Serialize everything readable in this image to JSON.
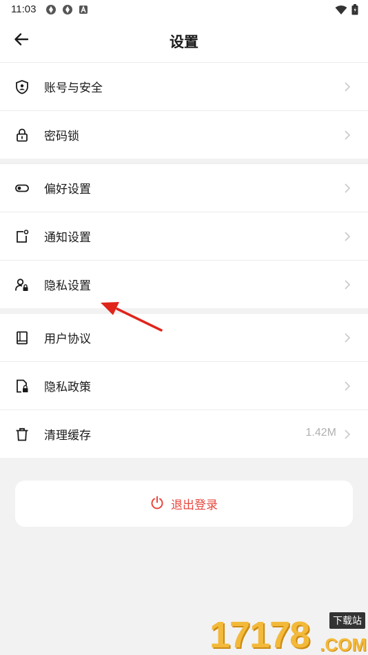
{
  "status_bar": {
    "time": "11:03",
    "left_icons": [
      "sync-icon",
      "sync-icon",
      "font-a-icon"
    ],
    "right_icons": [
      "wifi-icon",
      "battery-icon"
    ]
  },
  "header": {
    "title": "设置",
    "back_icon": "back-arrow-icon"
  },
  "groups": [
    {
      "items": [
        {
          "label": "账号与安全",
          "icon": "shield-user-icon"
        },
        {
          "label": "密码锁",
          "icon": "lock-icon"
        }
      ]
    },
    {
      "items": [
        {
          "label": "偏好设置",
          "icon": "toggle-icon"
        },
        {
          "label": "通知设置",
          "icon": "notification-icon"
        },
        {
          "label": "隐私设置",
          "icon": "user-lock-icon"
        }
      ]
    },
    {
      "items": [
        {
          "label": "用户协议",
          "icon": "book-icon"
        },
        {
          "label": "隐私政策",
          "icon": "doc-lock-icon"
        },
        {
          "label": "清理缓存",
          "icon": "trash-icon",
          "value": "1.42M"
        }
      ]
    }
  ],
  "logout": {
    "label": "退出登录",
    "icon": "power-icon",
    "color": "#e8453c"
  },
  "annotation": {
    "type": "red-arrow",
    "points_to": "隐私设置",
    "color": "#e0251b"
  },
  "watermark": {
    "number": "17178",
    "tag": "下载站",
    "domain": ".COM"
  },
  "colors": {
    "background": "#f2f2f2",
    "card": "#ffffff",
    "text": "#1a1a1a",
    "muted": "#b0b0b0",
    "accent": "#e8453c"
  }
}
